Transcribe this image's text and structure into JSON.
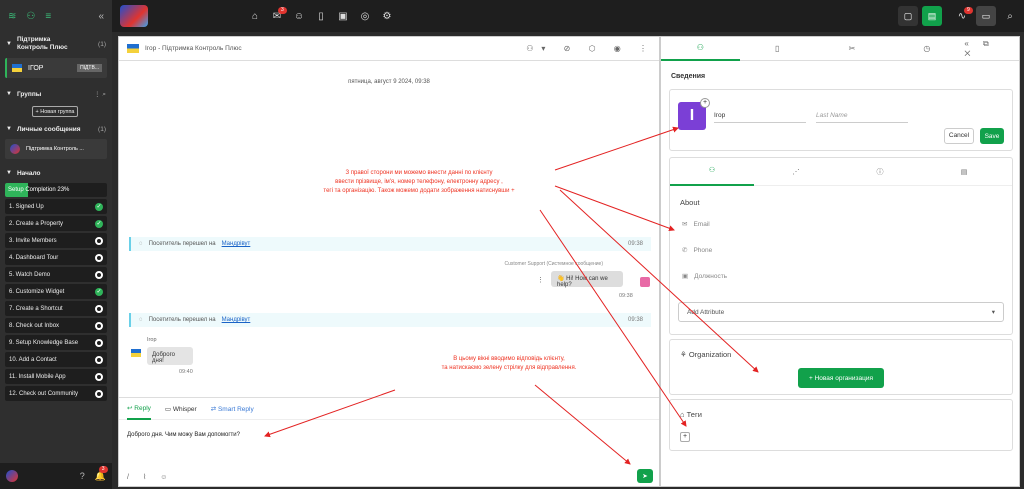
{
  "sidebar": {
    "support_title": "Підтримка Контроль Плюс",
    "support_count": "(1)",
    "channel_name": "ІГОР",
    "channel_badge": "ПІДТВ...",
    "groups_label": "Группы",
    "new_group": "+ Новая группа",
    "dm_label": "Личные сообщения",
    "dm_count": "(1)",
    "dm_item": "Підтримка Контроль ...",
    "start_label": "Начало",
    "setup_completion": "Setup Completion 23%",
    "setup_progress": 0.23,
    "steps": [
      "1. Signed Up",
      "2. Create a Property",
      "3. Invite Members",
      "4. Dashboard Tour",
      "5. Watch Demo",
      "6. Customize Widget",
      "7. Create a Shortcut",
      "8. Check out Inbox",
      "9. Setup Knowledge Base",
      "10. Add a Contact",
      "11. Install Mobile App",
      "12. Check out Community"
    ],
    "steps_done": [
      true,
      true,
      false,
      false,
      false,
      true,
      false,
      false,
      false,
      false,
      false,
      false
    ],
    "bell_count": "3"
  },
  "topbar": {
    "mail_count": "3",
    "activity_count": "9"
  },
  "chat": {
    "title": "Ігор - Підтримка Контроль Плюс",
    "date": "пятница, август 9 2024, 09:38",
    "sys1_text": "Посетитель перешел на",
    "sys1_link": "Мандрівут",
    "sys1_time": "09:38",
    "support_label": "Customer Support (Системное сообщение)",
    "support_msg": "👋 Hi! How can we help?",
    "support_time": "09:38",
    "sys2_text": "Посетитель перешел на",
    "sys2_link": "Мандрівут",
    "sys2_time": "09:38",
    "visitor_name": "Ігор",
    "visitor_msg": "Доброго дня!",
    "visitor_time": "09:40",
    "tab_reply": "Reply",
    "tab_whisper": "Whisper",
    "tab_smart": "Smart Reply",
    "input_text": "Доброго дня. Чим можу Вам допомогти?"
  },
  "annotations": {
    "top": "З правої сторони ми можемо внести данні по клієнту\nввести прізвище, ім'я, номер телефону, електронну адресу ,\nтегі та організацію. Також можемо додати зображення натиснувши +",
    "bottom": "В цьому  вікні вводимо відповідь клієнту,\nта натискаємо зелену стрілку для відправлення."
  },
  "details": {
    "section_title": "Сведения",
    "avatar_letter": "І",
    "first_name": "Ігор",
    "last_name_placeholder": "Last Name",
    "cancel": "Cancel",
    "save": "Save",
    "about": "About",
    "email": "Email",
    "phone": "Phone",
    "position": "Должность",
    "add_attribute": "Add Attribute",
    "organization": "Organization",
    "new_org": "+ Новая организация",
    "tags": "Теги"
  },
  "colors": {
    "accent": "#11a14b",
    "annotation": "#e32222",
    "avatar": "#7b3fd6"
  }
}
